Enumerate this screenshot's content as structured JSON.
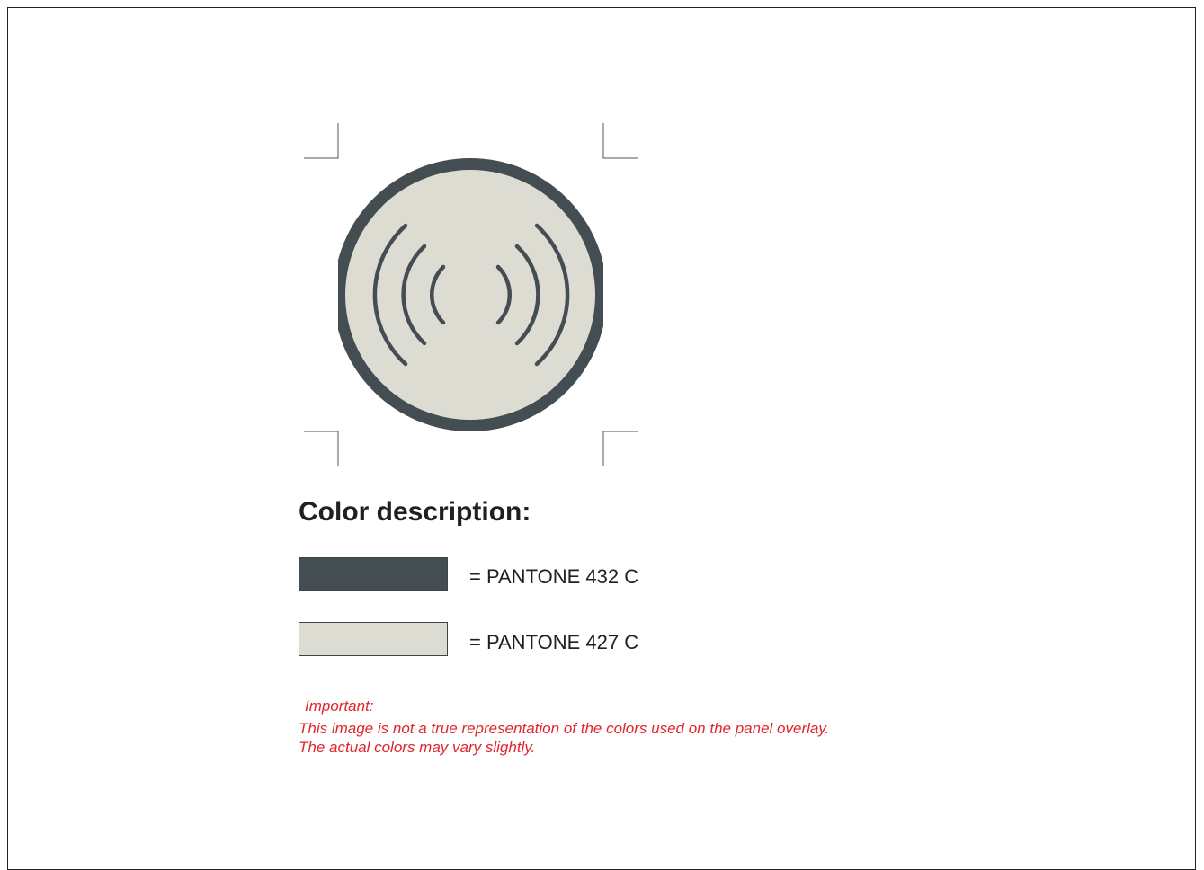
{
  "heading": "Color description:",
  "colors": {
    "dark": "#434d52",
    "light": "#dddcd3",
    "note_red": "#e0262b"
  },
  "swatches": [
    {
      "label": "= PANTONE 432 C",
      "color": "#434d52"
    },
    {
      "label": "= PANTONE 427 C",
      "color": "#dddcd3"
    }
  ],
  "note": {
    "title": "Important:",
    "line1": "This image is not a true representation of the colors used on the panel overlay.",
    "line2": "The actual colors may vary slightly."
  },
  "icon": "wireless-signal-icon"
}
